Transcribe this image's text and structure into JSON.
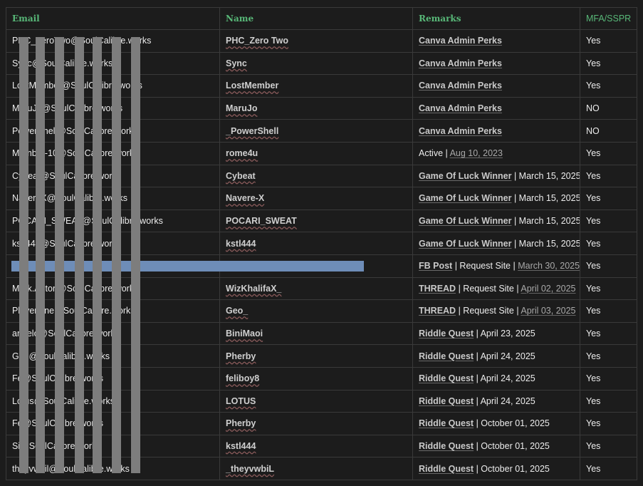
{
  "table": {
    "headers": {
      "email": "Email",
      "name": "Name",
      "remarks": "Remarks",
      "mfa": "MFA/SSPR"
    },
    "rows": [
      {
        "email": "PHC_ZeroTwo@SoulCalibre.works",
        "name": "PHC_Zero Two",
        "remarks": [
          {
            "t": "Canva Admin Perks",
            "k": "link"
          }
        ],
        "mfa": "Yes"
      },
      {
        "email": "Sync@SoulCalibre.works",
        "name": "Sync",
        "remarks": [
          {
            "t": "Canva Admin Perks",
            "k": "link"
          }
        ],
        "mfa": "Yes"
      },
      {
        "email": "LostMember@SoulCalibre.works",
        "name": "LostMember",
        "remarks": [
          {
            "t": "Canva Admin Perks",
            "k": "link"
          }
        ],
        "mfa": "Yes"
      },
      {
        "email": "MaruJo@SoulCalibre.works",
        "name": "MaruJo",
        "remarks": [
          {
            "t": "Canva Admin Perks",
            "k": "link"
          }
        ],
        "mfa": "NO"
      },
      {
        "email": "PowerShell@SoulCalibre.works",
        "name": "_PowerShell",
        "remarks": [
          {
            "t": "Canva Admin Perks",
            "k": "link"
          }
        ],
        "mfa": "NO"
      },
      {
        "email": "Member-10@SoulCalibre.works",
        "name": "rome4u",
        "remarks": [
          {
            "t": "Active",
            "k": "plain"
          },
          {
            "t": " | ",
            "k": "sep"
          },
          {
            "t": "Aug 10, 2023",
            "k": "muted"
          }
        ],
        "mfa": "Yes"
      },
      {
        "email": "Cybeat@SoulCalibre.works",
        "name": "Cybeat",
        "remarks": [
          {
            "t": "Game Of Luck Winner",
            "k": "link"
          },
          {
            "t": " | March 15, 2025",
            "k": "sep"
          }
        ],
        "mfa": "Yes"
      },
      {
        "email": "NavereX@SoulCalibre.works",
        "name": "Navere-X",
        "remarks": [
          {
            "t": "Game Of Luck Winner",
            "k": "link"
          },
          {
            "t": " | March 15, 2025",
            "k": "sep"
          }
        ],
        "mfa": "Yes"
      },
      {
        "email": "POCARI_SWEAT@SoulCalibre.works",
        "name": "POCARI_SWEAT",
        "remarks": [
          {
            "t": "Game Of Luck Winner",
            "k": "link"
          },
          {
            "t": " | March 15, 2025",
            "k": "sep"
          }
        ],
        "mfa": "Yes"
      },
      {
        "email": "kstl444@SoulCalibre.works",
        "name": "kstl444",
        "remarks": [
          {
            "t": "Game Of Luck Winner",
            "k": "link"
          },
          {
            "t": " | March 15, 2025",
            "k": "sep"
          }
        ],
        "mfa": "Yes"
      },
      {
        "email": "",
        "name": "",
        "remarks": [
          {
            "t": "FB Post",
            "k": "link"
          },
          {
            "t": " | Request Site | ",
            "k": "sep"
          },
          {
            "t": "March 30, 2025",
            "k": "muted"
          }
        ],
        "mfa": "Yes"
      },
      {
        "email": "Mark.Anton@SoulCalibre.works",
        "name": "WizKhalifaX_",
        "remarks": [
          {
            "t": "THREAD",
            "k": "link"
          },
          {
            "t": " | Request Site | ",
            "k": "sep"
          },
          {
            "t": "April 02, 2025",
            "k": "muted"
          }
        ],
        "mfa": "Yes"
      },
      {
        "email": "PlayerOne@SoulCalibre.works",
        "name": "Geo_",
        "remarks": [
          {
            "t": "THREAD",
            "k": "link"
          },
          {
            "t": " | Request Site | ",
            "k": "sep"
          },
          {
            "t": "April 03, 2025",
            "k": "muted"
          }
        ],
        "mfa": "Yes"
      },
      {
        "email": "angelo@SoulCalibre.works",
        "name": "BiniMaoi",
        "remarks": [
          {
            "t": "Riddle Quest",
            "k": "link"
          },
          {
            "t": " | April 23, 2025",
            "k": "sep"
          }
        ],
        "mfa": "Yes"
      },
      {
        "email": "Geo@SoulCalibre.works",
        "name": "Pherby",
        "remarks": [
          {
            "t": "Riddle Quest",
            "k": "link"
          },
          {
            "t": " | April 24, 2025",
            "k": "sep"
          }
        ],
        "mfa": "Yes"
      },
      {
        "email": "Fe@SoulCalibre.works",
        "name": "feliboy8",
        "remarks": [
          {
            "t": "Riddle Quest",
            "k": "link"
          },
          {
            "t": " | April 24, 2025",
            "k": "sep"
          }
        ],
        "mfa": "Yes"
      },
      {
        "email": "Lotus@SoulCalibre.works",
        "name": "LOTUS",
        "remarks": [
          {
            "t": "Riddle Quest",
            "k": "link"
          },
          {
            "t": " | April 24, 2025",
            "k": "sep"
          }
        ],
        "mfa": "Yes"
      },
      {
        "email": "Fe@SoulCalibre.works",
        "name": "Pherby",
        "remarks": [
          {
            "t": "Riddle Quest",
            "k": "link"
          },
          {
            "t": " | October 01, 2025",
            "k": "sep"
          }
        ],
        "mfa": "Yes"
      },
      {
        "email": "Si@SoulCalibre.works",
        "name": "kstl444",
        "remarks": [
          {
            "t": "Riddle Quest",
            "k": "link"
          },
          {
            "t": " | October 01, 2025",
            "k": "sep"
          }
        ],
        "mfa": "Yes"
      },
      {
        "email": "theyvwbil@SoulCalibre.works",
        "name": "_theyvwbiL",
        "remarks": [
          {
            "t": "Riddle Quest",
            "k": "link"
          },
          {
            "t": " | October 01, 2025",
            "k": "sep"
          }
        ],
        "mfa": "Yes"
      }
    ]
  },
  "colors": {
    "background": "#1c1c1c",
    "header_text": "#58b878",
    "border": "#3a3a3a",
    "redaction_gray": "#7d7d7d",
    "redaction_blue": "#6e8db8"
  }
}
